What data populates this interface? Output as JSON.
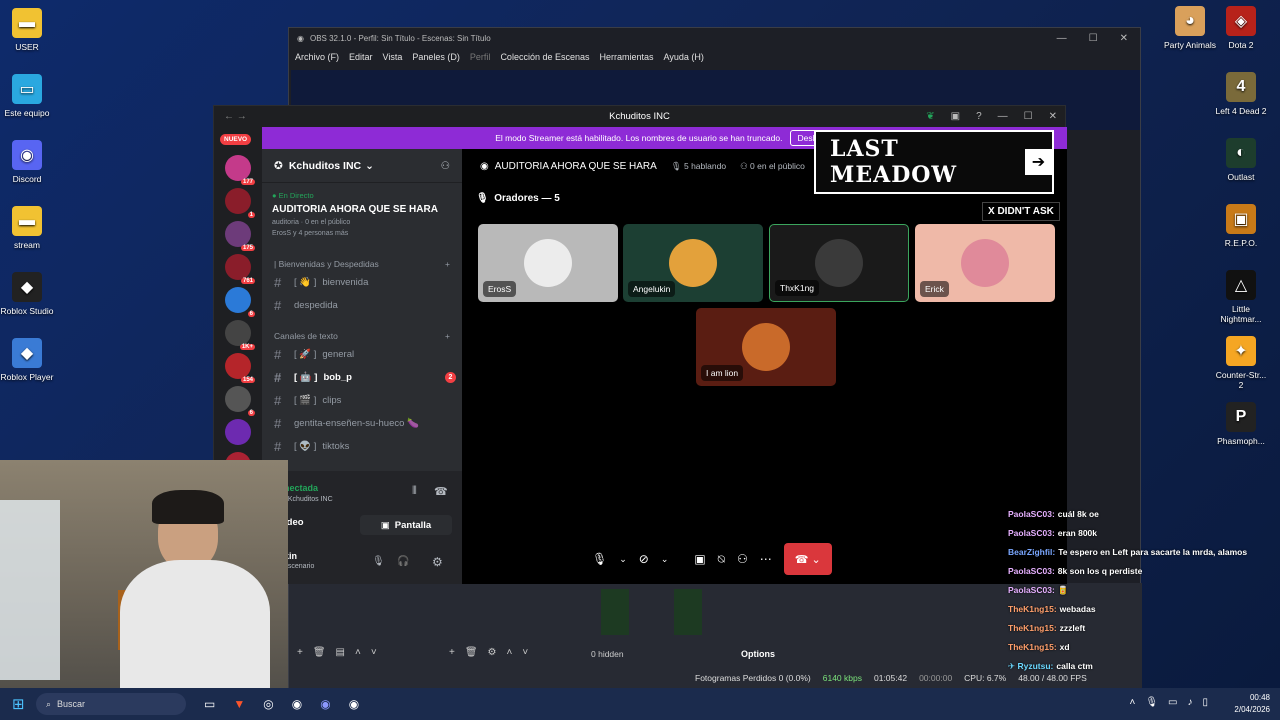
{
  "desktop": {
    "left_icons": [
      {
        "label": "USER",
        "color": "#f1c232",
        "glyph": "▬"
      },
      {
        "label": "Este equipo",
        "color": "#2aa8e0",
        "glyph": "▭"
      },
      {
        "label": "Discord",
        "color": "#5865f2",
        "glyph": "◉"
      },
      {
        "label": "stream",
        "color": "#f1c232",
        "glyph": "▬"
      },
      {
        "label": "Roblox Studio",
        "color": "#222",
        "glyph": "◆"
      },
      {
        "label": "Roblox Player",
        "color": "#3a7bd5",
        "glyph": "◆"
      }
    ],
    "right_icons_col1": [
      {
        "label": "Party Animals",
        "color": "#d9a05b",
        "glyph": "◕"
      }
    ],
    "right_icons_col2": [
      {
        "label": "Dota 2",
        "color": "#b7221a",
        "glyph": "◈"
      },
      {
        "label": "Left 4 Dead 2",
        "color": "#7a6a3a",
        "glyph": "4"
      },
      {
        "label": "Outlast",
        "color": "#1d3d2d",
        "glyph": "◐"
      },
      {
        "label": "R.E.P.O.",
        "color": "#c87a18",
        "glyph": "▣"
      },
      {
        "label": "Little Nightmar...",
        "color": "#111",
        "glyph": "△"
      },
      {
        "label": "Counter-Str... 2",
        "color": "#f5a623",
        "glyph": "✦"
      },
      {
        "label": "Phasmoph...",
        "color": "#222",
        "glyph": "P"
      }
    ]
  },
  "obs": {
    "title": "OBS 32.1.0 - Perfil: Sin Título - Escenas: Sin Título",
    "menu": [
      "Archivo (F)",
      "Editar",
      "Vista",
      "Paneles (D)",
      "Perfil",
      "Colección de Escenas",
      "Herramientas",
      "Ayuda (H)"
    ],
    "status": {
      "dropped": "Fotogramas Perdidos 0 (0.0%)",
      "bitrate": "6140 kbps",
      "live_time": "01:05:42",
      "rec_time": "00:00:00",
      "cpu": "CPU: 6.7%",
      "fps": "48.00 / 48.00 FPS"
    },
    "hidden_label": "0 hidden",
    "options_label": "Options"
  },
  "discord": {
    "window_title": "Kchuditos INC",
    "banner_text": "El modo Streamer está habilitado. Los nombres de usuario se han truncado.",
    "banner_button": "Deshab",
    "new_badge": "NUEVO",
    "server_name": "Kchuditos INC",
    "live": {
      "tag": "En Directo",
      "title": "AUDITORIA AHORA QUE SE HARA",
      "sub": "auditoria · 0 en el público",
      "viewers": "ErosS y 4 personas más"
    },
    "categories": {
      "welcome": "| Bienvenidas y Despedidas",
      "text": "Canales de texto"
    },
    "channels_welcome": [
      {
        "name": "bienvenida",
        "prefix": "[ 👋 ]"
      },
      {
        "name": "despedida",
        "prefix": ""
      }
    ],
    "channels_text": [
      {
        "name": "general",
        "prefix": "[ 🚀 ]",
        "active": false,
        "ping": ""
      },
      {
        "name": "bob_p",
        "prefix": "[ 🤖 ]",
        "active": true,
        "ping": "2"
      },
      {
        "name": "clips",
        "prefix": "[ 🎬 ]",
        "active": false,
        "ping": ""
      },
      {
        "name": "gentita-enseñen-su-hueco 🍆",
        "prefix": "",
        "active": false,
        "ping": ""
      },
      {
        "name": "tiktoks",
        "prefix": "[ 👽 ]",
        "active": false,
        "ping": ""
      }
    ],
    "voice_panel": {
      "status": "nectada",
      "server": "/ Kchuditos INC",
      "video_btn": "ideo",
      "screen_btn": "Pantalla",
      "user": "kin",
      "user_sub": "escenario"
    },
    "stage": {
      "title": "AUDITORIA AHORA QUE SE HARA",
      "speaking": "5 hablando",
      "audience": "0 en el público",
      "speakers_label": "Oradores — 5"
    },
    "tiles": [
      {
        "name": "ErosS",
        "bg": "#b9b9b9",
        "avatar": "#ececec"
      },
      {
        "name": "Angelukin",
        "bg": "#1c3f33",
        "avatar": "#e3a13b"
      },
      {
        "name": "ThxK1ng",
        "bg": "#1a1a1a",
        "avatar": "#3a3a3a"
      },
      {
        "name": "Erick",
        "bg": "#efb9a8",
        "avatar": "#e08a9a"
      },
      {
        "name": "I am lion",
        "bg": "#5a1d12",
        "avatar": "#c96a2a"
      }
    ],
    "server_badges": [
      "177",
      "1",
      "175",
      "761",
      "6",
      "1K+",
      "154",
      "6",
      "",
      ""
    ]
  },
  "ad": {
    "title": "LAST MEADOW",
    "close": "X DIDN'T ASK"
  },
  "chat": [
    {
      "user": "PaolaSC03:",
      "msg": "cuál 8k oe",
      "color": "#e6b0ff"
    },
    {
      "user": "PaolaSC03:",
      "msg": "eran 800k",
      "color": "#e6b0ff"
    },
    {
      "user": "BearZighfil:",
      "msg": "Te espero en Left para sacarte la mrda, alamos",
      "color": "#7aa7ff"
    },
    {
      "user": "PaolaSC03:",
      "msg": "8k son los q perdiste",
      "color": "#e6b0ff"
    },
    {
      "user": "PaolaSC03:",
      "msg": "🥫",
      "color": "#e6b0ff"
    },
    {
      "user": "TheK1ng15:",
      "msg": "webadas",
      "color": "#ff9f6b"
    },
    {
      "user": "TheK1ng15:",
      "msg": "zzzleft",
      "color": "#ff9f6b"
    },
    {
      "user": "TheK1ng15:",
      "msg": "xd",
      "color": "#ff9f6b"
    },
    {
      "user": "✈ Ryzutsu:",
      "msg": "calla ctm",
      "color": "#6bd8ff"
    }
  ],
  "taskbar": {
    "search": "Buscar",
    "time": "00:48",
    "date": "2/04/2026"
  }
}
